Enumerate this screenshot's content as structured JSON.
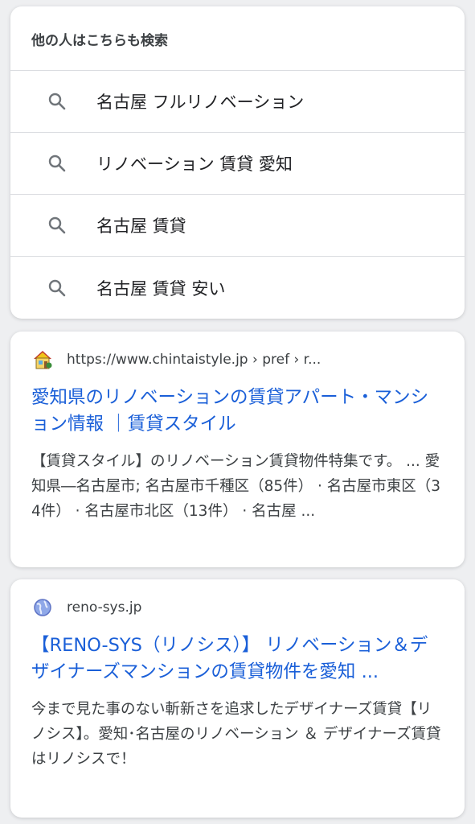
{
  "people_also_search": {
    "heading": "他の人はこちらも検索",
    "items": [
      {
        "label": "名古屋 フルリノベーション",
        "icon": "search-icon"
      },
      {
        "label": "リノベーション 賃貸 愛知",
        "icon": "search-icon"
      },
      {
        "label": "名古屋 賃貸",
        "icon": "search-icon"
      },
      {
        "label": "名古屋 賃貸 安い",
        "icon": "search-icon"
      }
    ]
  },
  "results": [
    {
      "favicon": "house-icon",
      "url": "https://www.chintaistyle.jp › pref › r...",
      "title": "愛知県のリノベーションの賃貸アパート・マンション情報 ｜賃貸スタイル",
      "snippet": "【賃貸スタイル】のリノベーション賃貸物件特集です。 ... 愛知県―名古屋市; 名古屋市千種区（85件） · 名古屋市東区（34件） · 名古屋市北区（13件） · 名古屋 ..."
    },
    {
      "favicon": "globe-icon",
      "url": "reno-sys.jp",
      "title": "【RENO-SYS（リノシス）】 リノベーション＆デザイナーズマンションの賃貸物件を愛知 ...",
      "snippet": "今まで見た事のない斬新さを追求したデザイナーズ賃貸【リノシス】。愛知･名古屋のリノベーション ＆ デザイナーズ賃貸はリノシスで！"
    }
  ],
  "colors": {
    "link": "#1a5fd8",
    "text": "#3c4043",
    "background": "#eeeff1",
    "card": "#ffffff"
  }
}
